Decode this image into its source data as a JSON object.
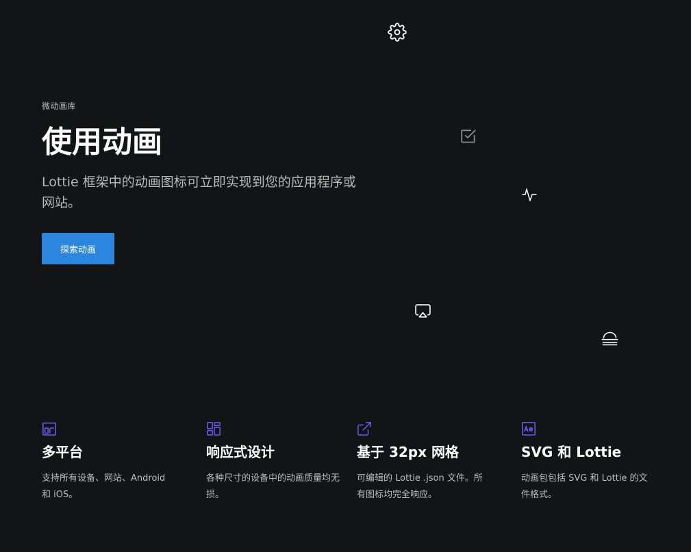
{
  "hero": {
    "eyebrow": "微动画库",
    "title": "使用动画",
    "subtitle": "Lottie 框架中的动画图标可立即实现到您的应用程序或网站。",
    "cta_label": "探索动画"
  },
  "floating_icons": [
    "gear-icon",
    "checkbox-icon",
    "activity-icon",
    "airplay-icon",
    "align-center-icon"
  ],
  "features": [
    {
      "icon": "multi-device-icon",
      "title": "多平台",
      "description": "支持所有设备、网站、Android 和 iOS。"
    },
    {
      "icon": "layout-grid-icon",
      "title": "响应式设计",
      "description": "各种尺寸的设备中的动画质量均无损。"
    },
    {
      "icon": "external-link-icon",
      "title": "基于 32px 网格",
      "description": "可编辑的 Lottie .json 文件。所有图标均完全响应。"
    },
    {
      "icon": "after-effects-icon",
      "title": "SVG 和 Lottie",
      "description": "动画包包括 SVG 和 Lottie 的文件格式。"
    }
  ],
  "colors": {
    "background": "#131415",
    "accent": "#2b86e0",
    "feature_icon": "#6d5dfc"
  }
}
